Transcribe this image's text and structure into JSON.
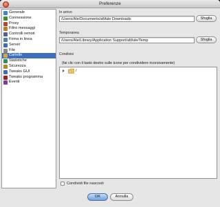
{
  "window": {
    "title": "Preferenze"
  },
  "sidebar": {
    "items": [
      {
        "label": "Generale",
        "icon": "gear-icon",
        "color": "#4a7fc1"
      },
      {
        "label": "Connessione",
        "icon": "connection-icon",
        "color": "#3a8c3a"
      },
      {
        "label": "Proxy",
        "icon": "proxy-icon",
        "color": "#b04a2c"
      },
      {
        "label": "Filtro messaggi",
        "icon": "filter-icon",
        "color": "#c07a20"
      },
      {
        "label": "Controlli remoti",
        "icon": "remote-icon",
        "color": "#5a5a9c"
      },
      {
        "label": "Firma in linea",
        "icon": "signature-icon",
        "color": "#5080b0"
      },
      {
        "label": "Server",
        "icon": "server-icon",
        "color": "#3d6fa8"
      },
      {
        "label": "File",
        "icon": "file-icon",
        "color": "#888888"
      },
      {
        "label": "Cartelle",
        "icon": "folder-icon",
        "color": "#d9a640",
        "selected": true
      },
      {
        "label": "Statistiche",
        "icon": "statistics-icon",
        "color": "#2f8f5a"
      },
      {
        "label": "Sicurezza",
        "icon": "security-icon",
        "color": "#b08a20"
      },
      {
        "label": "Tweaks GUI",
        "icon": "tweaks-gui-icon",
        "color": "#3d6fa8"
      },
      {
        "label": "Tweaks programma",
        "icon": "tweaks-program-icon",
        "color": "#a02020"
      },
      {
        "label": "Eventi",
        "icon": "events-icon",
        "color": "#7a3d9c"
      }
    ]
  },
  "incoming": {
    "label": "In arrivo",
    "path": "/Users/Ale/Documents/aMule Downloads",
    "browse_label": "Sfoglia"
  },
  "temp": {
    "label": "Temporanea",
    "path": "/Users/Ale/Library/Application Support/aMule/Temp",
    "browse_label": "Sfoglia"
  },
  "shared": {
    "label": "Condivisi",
    "hint": "(fai clic con il tasto destro sulle icone per condividere ricorsivamente)",
    "tree_root": "/",
    "hidden_files_label": "Condividi file nascosti"
  },
  "footer": {
    "ok_label": "OK",
    "cancel_label": "Annulla"
  }
}
